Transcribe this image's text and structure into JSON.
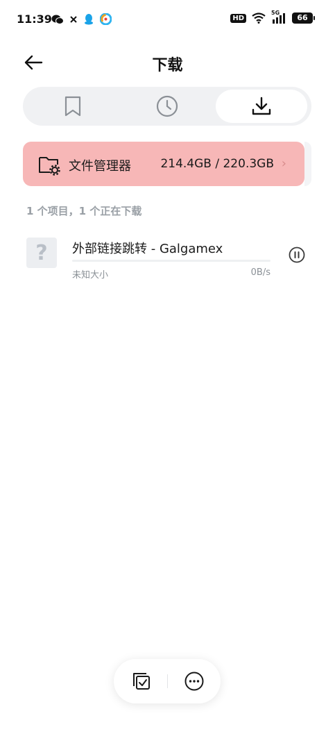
{
  "status_bar": {
    "time": "11:39",
    "left_icons": [
      "wechat-icon",
      "x-icon",
      "qq-icon",
      "browser-icon"
    ],
    "hd": "HD",
    "network": "5G",
    "battery": "66"
  },
  "header": {
    "title": "下载"
  },
  "tabs": [
    {
      "name": "bookmarks",
      "icon": "bookmark-icon",
      "active": false
    },
    {
      "name": "history",
      "icon": "clock-icon",
      "active": false
    },
    {
      "name": "downloads",
      "icon": "download-icon",
      "active": true
    }
  ],
  "storage": {
    "label": "文件管理器",
    "usage": "214.4GB / 220.3GB",
    "fill_fraction": 0.973,
    "color": "#f7b7b7"
  },
  "downloads": {
    "summary": "1 个项目，1 个正在下载",
    "items": [
      {
        "title": "外部链接跳转 - Galgamex",
        "size": "未知大小",
        "speed": "0B/s",
        "progress": 0,
        "icon": "unknown-file-icon"
      }
    ]
  },
  "bottom_bar": {
    "buttons": [
      "select-icon",
      "more-icon"
    ]
  },
  "colors": {
    "accent": "#5c8df5",
    "muted_text": "#9aa0a6",
    "tab_background": "#f0f1f3"
  }
}
